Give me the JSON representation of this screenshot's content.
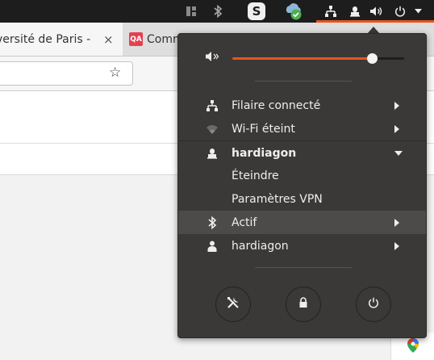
{
  "colors": {
    "panel": "#1d1d1d",
    "accent": "#e95420",
    "menu_bg": "#3a3937",
    "menu_highlight": "#4c4b49",
    "menu_text": "#eeeeec",
    "qa_badge": "#e4404f"
  },
  "top_panel": {
    "tray_icons": [
      "window-icon",
      "bluetooth-icon",
      "skype-icon",
      "cloud-sync-icon",
      "network-wired-icon",
      "vpn-icon",
      "volume-icon",
      "power-icon",
      "dropdown-arrow-icon"
    ],
    "skype_letter": "S"
  },
  "browser": {
    "tabs": [
      {
        "title": "versité de Paris -",
        "close": "×"
      },
      {
        "badge": "QA",
        "title": "Comm"
      }
    ]
  },
  "system_menu": {
    "volume_level": 0.81,
    "items": [
      {
        "icon": "network-wired-icon",
        "label": "Filaire connecté",
        "submenu": true
      },
      {
        "icon": "wifi-icon",
        "label": "Wi-Fi éteint",
        "submenu": true
      },
      {
        "icon": "vpn-icon",
        "label": "hardiagon",
        "expanded": true
      },
      {
        "label": "Éteindre"
      },
      {
        "label": "Paramètres VPN"
      },
      {
        "icon": "bluetooth-icon",
        "label": "Actif",
        "submenu": true
      },
      {
        "icon": "user-icon",
        "label": "hardiagon",
        "submenu": true
      }
    ],
    "round_buttons": [
      "settings-icon",
      "lock-icon",
      "power-icon"
    ]
  }
}
